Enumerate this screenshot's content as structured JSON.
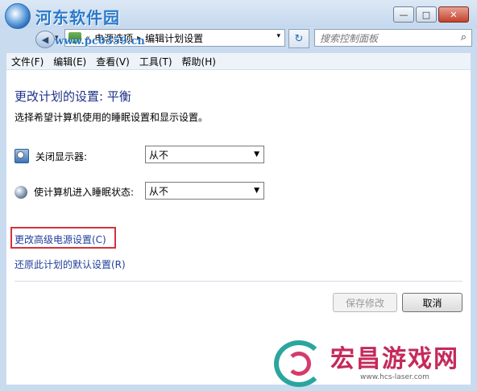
{
  "watermark": {
    "site": "河东软件园",
    "url": "www.pc0359.cn"
  },
  "window_controls": {
    "minimize": "—",
    "maximize": "□",
    "close": "✕"
  },
  "address": {
    "chevron": "«",
    "crumbs": [
      "电源选项",
      "编辑计划设置"
    ],
    "separator": "▸",
    "dropdown": "▾"
  },
  "search": {
    "placeholder": "搜索控制面板",
    "icon": "search-icon"
  },
  "menu": [
    "文件(F)",
    "编辑(E)",
    "查看(V)",
    "工具(T)",
    "帮助(H)"
  ],
  "main": {
    "title": "更改计划的设置: 平衡",
    "description": "选择希望计算机使用的睡眠设置和显示设置。",
    "settings": [
      {
        "label": "关闭显示器:",
        "value": "从不",
        "icon": "display-icon"
      },
      {
        "label": "使计算机进入睡眠状态:",
        "value": "从不",
        "icon": "sleep-icon"
      }
    ],
    "links": [
      "更改高级电源设置(C)",
      "还原此计划的默认设置(R)"
    ],
    "buttons": {
      "save": "保存修改",
      "cancel": "取消"
    }
  },
  "footer_brand": {
    "name": "宏昌游戏网",
    "url": "www.hcs-laser.com"
  },
  "colors": {
    "title": "#1e3287",
    "link": "#1f3f9a",
    "highlight": "#d2343a"
  }
}
